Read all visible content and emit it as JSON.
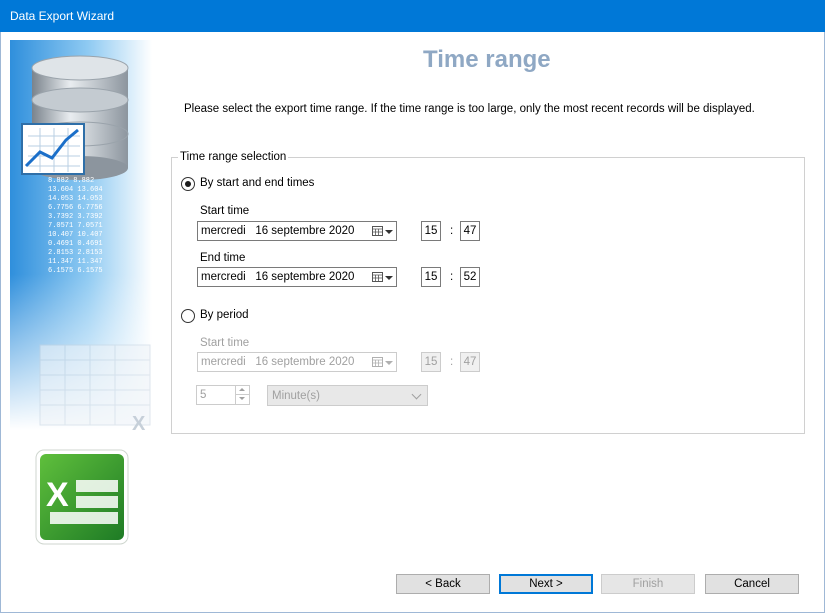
{
  "window": {
    "title": "Data Export Wizard"
  },
  "page": {
    "title": "Time range",
    "instruction": "Please select the export time range. If the time range is too large, only the most recent records will be displayed."
  },
  "group": {
    "legend": "Time range selection",
    "by_times": {
      "label": "By start and end times",
      "selected": true,
      "start_label": "Start time",
      "start_date": "mercredi   16 septembre 2020",
      "start_hour": "15",
      "start_minute": "47",
      "end_label": "End time",
      "end_date": "mercredi   16 septembre 2020",
      "end_hour": "15",
      "end_minute": "52"
    },
    "by_period": {
      "label": "By period",
      "selected": false,
      "start_label": "Start time",
      "start_date": "mercredi   16 septembre 2020",
      "start_hour": "15",
      "start_minute": "47",
      "period_value": "5",
      "unit": "Minute(s)"
    },
    "separator": ":"
  },
  "sidebar": {
    "numbers": [
      "8.882  8.882",
      "13.604 13.604",
      "14.053 14.053",
      "6.7756 6.7756",
      "3.7392 3.7392",
      "7.0571 7.0571",
      "10.407 10.407",
      "0.4691 0.4691",
      "2.8153 2.8153",
      "11.347 11.347",
      "6.1575 6.1575"
    ],
    "excel_letter": "X"
  },
  "buttons": {
    "back": "< Back",
    "next": "Next >",
    "finish": "Finish",
    "cancel": "Cancel"
  },
  "colors": {
    "titlebar": "#0078d7",
    "page_title": "#8fa8c4",
    "default_button_border": "#0078d7"
  }
}
